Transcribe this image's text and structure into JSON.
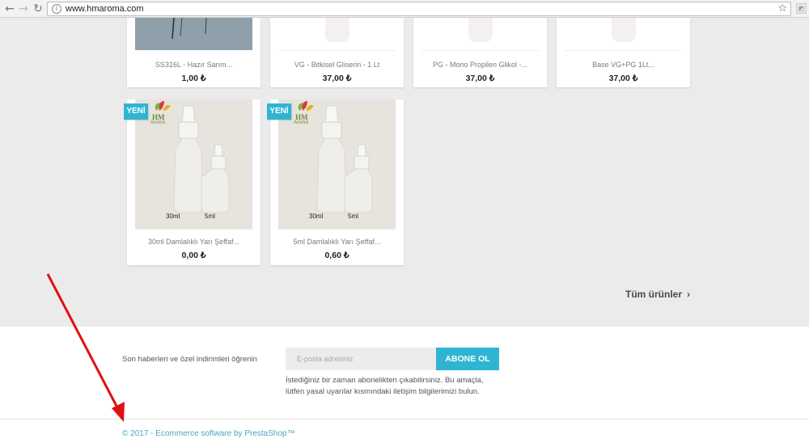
{
  "browser": {
    "url": "www.hmaroma.com",
    "back_icon": "back-arrow-icon",
    "forward_icon": "forward-arrow-icon",
    "reload_icon": "reload-icon",
    "bookmark_icon": "star-icon"
  },
  "products_top": [
    {
      "name": "SS316L - Hazır Sarım...",
      "price": "1,00 ₺"
    },
    {
      "name": "VG - Bitkisel Gliserin - 1 Lt",
      "price": "37,00 ₺"
    },
    {
      "name": "PG - Mono Propilen Glikol -...",
      "price": "37,00 ₺"
    },
    {
      "name": "Base VG+PG 1Lt...",
      "price": "37,00 ₺"
    }
  ],
  "products_bottom": [
    {
      "badge": "YENİ",
      "logo_text": "HM",
      "logo_sub": "AromA",
      "label_large": "30ml",
      "label_small": "5ml",
      "name": "30ml Damlalıklı Yarı Şeffaf...",
      "price": "0,00 ₺"
    },
    {
      "badge": "YENİ",
      "logo_text": "HM",
      "logo_sub": "AromA",
      "label_large": "30ml",
      "label_small": "5ml",
      "name": "5ml Damlalıklı Yarı Şeffaf...",
      "price": "0,60 ₺"
    }
  ],
  "all_products_label": "Tüm ürünler",
  "newsletter": {
    "text": "Son haberleri ve özel indirimleri öğrenin",
    "placeholder": "E-posta adresiniz",
    "button": "ABONE OL",
    "note": "İstediğiniz bir zaman abonelikten çıkabilirsiniz. Bu amaçla, lütfen yasal uyarılar kısmındaki iletişim bilgilerimizi bulun."
  },
  "footer": {
    "copyright": "© 2017 - Ecommerce software by PrestaShop™"
  },
  "colors": {
    "accent": "#2fb5d2",
    "annotation_arrow": "#e01010"
  }
}
